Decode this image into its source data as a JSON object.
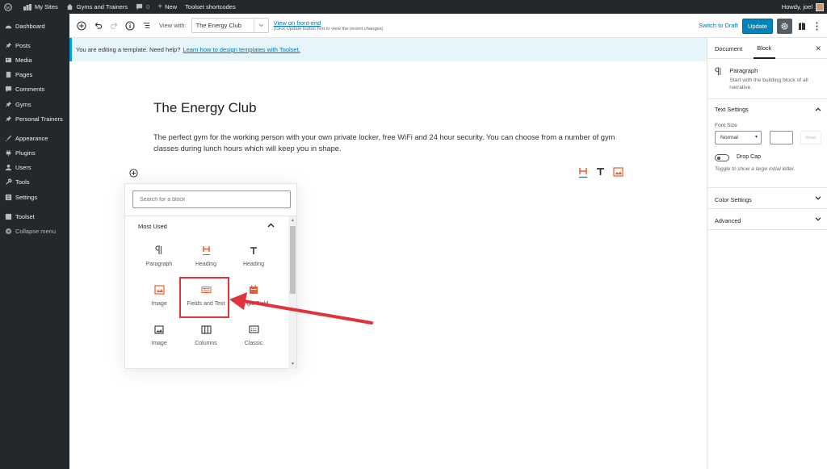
{
  "admin_bar": {
    "my_sites": "My Sites",
    "site_name": "Gyms and Trainers",
    "comments_count": "0",
    "new_label": "New",
    "toolset_shortcodes": "Toolset shortcodes",
    "howdy": "Howdy, joel"
  },
  "sidebar": {
    "items": [
      {
        "label": "Dashboard",
        "icon": "dashboard-icon"
      },
      {
        "label": "Posts",
        "icon": "pin-icon"
      },
      {
        "label": "Media",
        "icon": "media-icon"
      },
      {
        "label": "Pages",
        "icon": "page-icon"
      },
      {
        "label": "Comments",
        "icon": "comment-icon"
      },
      {
        "label": "Gyms",
        "icon": "pin-icon"
      },
      {
        "label": "Personal Trainers",
        "icon": "pin-icon"
      },
      {
        "label": "Appearance",
        "icon": "brush-icon"
      },
      {
        "label": "Plugins",
        "icon": "plugin-icon"
      },
      {
        "label": "Users",
        "icon": "user-icon"
      },
      {
        "label": "Tools",
        "icon": "wrench-icon"
      },
      {
        "label": "Settings",
        "icon": "settings-icon"
      },
      {
        "label": "Toolset",
        "icon": "toolset-icon"
      },
      {
        "label": "Collapse menu",
        "icon": "collapse-icon"
      }
    ]
  },
  "toolbar": {
    "view_with_label": "View with:",
    "view_with_value": "The Energy Club",
    "front_end_link": "View on front-end",
    "front_end_note": "(Click Update button first to view the recent changes)",
    "switch_to_draft": "Switch to Draft",
    "update": "Update"
  },
  "notice": {
    "text": "You are editing a template. Need help?",
    "link": "Learn how to design templates with Toolset."
  },
  "content": {
    "title": "The Energy Club",
    "body": "The perfect gym for the working person with your own private locker, free WiFi and 24 hour security. You can choose from a number of gym classes during lunch hours which will keep you in shape."
  },
  "inserter": {
    "search_placeholder": "Search for a block",
    "panel_title": "Most Used",
    "blocks": [
      {
        "label": "Paragraph",
        "icon": "paragraph-icon"
      },
      {
        "label": "Heading",
        "icon": "heading-h-icon"
      },
      {
        "label": "Heading",
        "icon": "heading-t-icon"
      },
      {
        "label": "Image",
        "icon": "image-icon"
      },
      {
        "label": "Fields and Text",
        "icon": "fields-and-text-icon"
      },
      {
        "label": "Single Field",
        "icon": "single-field-icon"
      },
      {
        "label": "Image",
        "icon": "image-icon"
      },
      {
        "label": "Columns",
        "icon": "columns-icon"
      },
      {
        "label": "Classic",
        "icon": "classic-icon"
      }
    ]
  },
  "settings": {
    "tab_document": "Document",
    "tab_block": "Block",
    "block_title": "Paragraph",
    "block_desc": "Start with the building block of all narrative.",
    "text_settings": "Text Settings",
    "font_size_label": "Font Size",
    "font_size_value": "Normal",
    "reset_label": "Reset",
    "drop_cap": "Drop Cap",
    "drop_cap_help": "Toggle to show a large initial letter.",
    "color_settings": "Color Settings",
    "advanced": "Advanced"
  },
  "colors": {
    "accent": "#0085ba",
    "toolset_orange": "#f05a28",
    "highlight_red": "#e0333a",
    "admin_dark": "#23282d"
  }
}
